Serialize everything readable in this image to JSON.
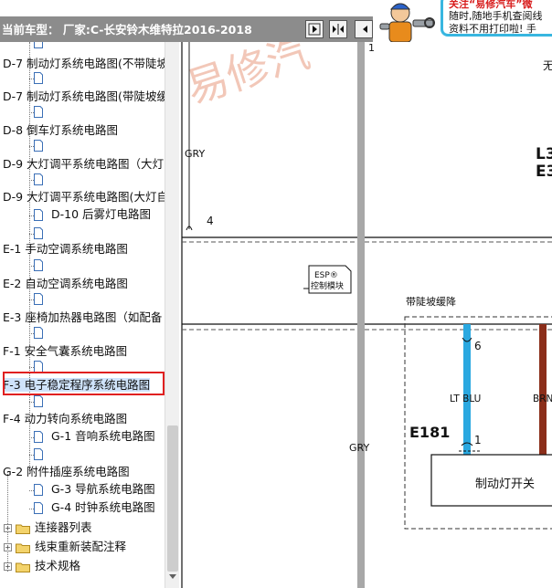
{
  "header": {
    "car_label": "当前车型： 厂家:C-长安铃木维特拉2016-2018",
    "promo_line1": "关注“易修汽车”微",
    "promo_line2": "随时,随地手机查阅线",
    "promo_line3": "资料不用打印啦! 手"
  },
  "tree": {
    "items": [
      {
        "label": "D-7 制动灯系统电路图(不带陡坡"
      },
      {
        "label": "D-7 制动灯系统电路图(带陡坡缓"
      },
      {
        "label": "D-8 倒车灯系统电路图"
      },
      {
        "label": "D-9 大灯调平系统电路图（大灯"
      },
      {
        "label": "D-9 大灯调平系统电路图(大灯自"
      },
      {
        "label": "D-10 后雾灯电路图"
      },
      {
        "label": "E-1 手动空调系统电路图"
      },
      {
        "label": "E-2 自动空调系统电路图"
      },
      {
        "label": "E-3 座椅加热器电路图（如配备"
      },
      {
        "label": "F-1 安全气囊系统电路图"
      },
      {
        "label": "F-3 电子稳定程序系统电路图"
      },
      {
        "label": "F-4 动力转向系统电路图"
      },
      {
        "label": "G-1 音响系统电路图"
      },
      {
        "label": "G-2 附件插座系统电路图"
      },
      {
        "label": "G-3 导航系统电路图"
      },
      {
        "label": "G-4 时钟系统电路图"
      },
      {
        "label": "连接器列表"
      },
      {
        "label": "线束重新装配注释"
      },
      {
        "label": "技术规格"
      }
    ]
  },
  "diagram": {
    "watermark": "易修汽",
    "top_label": "无",
    "wire_gry_top": "GRY",
    "pin_4": "4",
    "esp_line1": "ESP®",
    "esp_line2": "控制模块",
    "l3": "L3",
    "e3": "E3",
    "box_label": "带陡坡缓降",
    "pin_6": "6",
    "wire_lt_blu": "LT BLU",
    "wire_brn": "BRN",
    "connector": "E181",
    "pin_1": "1",
    "wire_gry_mid": "GRY",
    "pin_1_top": "1",
    "switch_label": "制动灯开关"
  },
  "colors": {
    "light_blue_wire": "#2aa8e0",
    "brown_wire": "#8b2e1a",
    "gray_wire": "#a8a8a8",
    "selection_border": "#e02020",
    "promo_border": "#38b6e0",
    "promo_red": "#d81e1e"
  }
}
